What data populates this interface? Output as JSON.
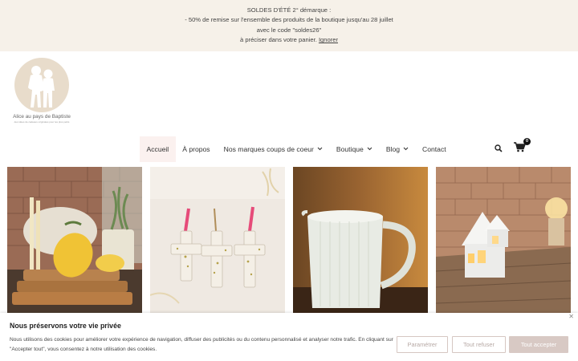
{
  "promo": {
    "line1": "SOLDES D'ÉTÉ 2° démarque :",
    "line2": "- 50% de remise sur l'ensemble des produits de la boutique jusqu'au 28 juillet",
    "line3": "avec le code \"soldes26\"",
    "line4_prefix": "à préciser dans votre panier. ",
    "dismiss": "Ignorer"
  },
  "logo": {
    "name": "Alice au pays de Baptiste",
    "tagline": "des idées de cadeaux originales pour les plus petits"
  },
  "nav": {
    "items": [
      {
        "label": "Accueil"
      },
      {
        "label": "À propos"
      },
      {
        "label": "Nos marques coups de coeur"
      },
      {
        "label": "Boutique"
      },
      {
        "label": "Blog"
      },
      {
        "label": "Contact"
      }
    ],
    "cart_count": "0"
  },
  "icons": {
    "search": "search-icon",
    "cart": "shopping-cart-icon",
    "dropdown": "chevron-down-icon",
    "close": "close-icon"
  },
  "cookie": {
    "title": "Nous préservons votre vie privée",
    "text": "Nous utilisons des cookies pour améliorer votre expérience de navigation, diffuser des publicités ou du contenu personnalisé et analyser notre trafic. En cliquant sur \"Accepter tout\", vous consentez à notre utilisation des cookies.",
    "settings_label": "Paramétrer",
    "reject_label": "Tout refuser",
    "accept_label": "Tout accepter"
  },
  "colors": {
    "banner_bg": "#f6f1e9",
    "active_nav_bg": "#fbf1ef",
    "accept_button": "#d8c9c4"
  }
}
